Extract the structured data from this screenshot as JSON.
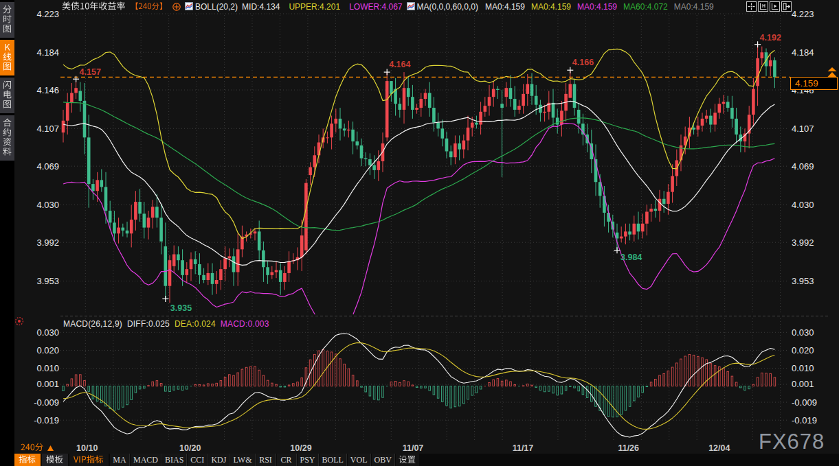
{
  "window": {
    "watermark": "FX678"
  },
  "icons": {
    "titlebar": [
      "collapse-indicator-icon",
      "boll-mini-chart-icon",
      "ma-mini-chart-icon"
    ],
    "top_right": [
      "pan-tool-icon",
      "axis-scale-k-icon",
      "axis-play-icon",
      "exit-chart-icon"
    ],
    "macd_panel": [
      "macd-indicator-icon"
    ],
    "price_axis": [
      "price-up-marker-icon"
    ],
    "period_row": [
      "period-dropdown-arrow-icon"
    ]
  },
  "colors": {
    "background": "#131313",
    "accent": "#ff8a00",
    "up": "#f0484e",
    "down": "#3fbd8e",
    "upper": "#ded535",
    "mid": "#f2f2f2",
    "lower": "#e23ce2",
    "ma60": "#2ca84e",
    "diff_line": "#f2f2f2",
    "dea_line": "#d8c42e",
    "hist_up": "#d34a4a",
    "hist_down": "#3aa880",
    "grid": "#3b3b3b"
  },
  "sidebar": {
    "items": [
      {
        "label": "分时图",
        "active": false
      },
      {
        "label": "K线图",
        "active": true
      },
      {
        "label": "闪电图",
        "active": false
      },
      {
        "label": "合约资料",
        "active": false
      }
    ]
  },
  "titlebar": {
    "instrument": "美债10年收益率",
    "period": "【240分】",
    "boll": {
      "name": "BOLL(20,2)",
      "mid": "MID:4.134",
      "upper": "UPPER:4.201",
      "lower": "LOWER:4.067"
    },
    "ma": {
      "name": "MA(0,0,0,60,0,0)",
      "ma0_white": "MA0:4.159",
      "ma0_yellow": "MA0:4.159",
      "ma0_magenta": "MA0:4.159",
      "ma60": "MA60:4.072",
      "ma0_gray": "MA0:4.159"
    }
  },
  "main_chart": {
    "current_price_label": "4.159"
  },
  "macd": {
    "header": {
      "name": "MACD(26,12,9)",
      "diff": "DIFF:0.025",
      "dea": "DEA:0.024",
      "macd": "MACD:0.003"
    }
  },
  "time_axis": {
    "period": "240分"
  },
  "bottom_toolbar": {
    "tabs": [
      {
        "label": "指标",
        "active": true,
        "vip": false
      },
      {
        "label": "模板",
        "active": false,
        "vip": false
      },
      {
        "label": "VIP指标",
        "active": false,
        "vip": true
      }
    ],
    "indicators": [
      "MA",
      "MACD",
      "BIAS",
      "CCI",
      "KDJ",
      "LW&",
      "RSI",
      "CR",
      "PSY",
      "BOLL",
      "VOL",
      "OBV"
    ],
    "settings": "设置"
  },
  "chart_data": [
    {
      "type": "candlestick",
      "title": "美债10年收益率【240分】",
      "period": "240分",
      "ylim": [
        3.928,
        4.231
      ],
      "y_ticks": [
        4.223,
        4.184,
        4.146,
        4.107,
        4.069,
        4.03,
        3.992,
        3.953
      ],
      "x_ticks": [
        {
          "label": "10/10",
          "bar": 5.6
        },
        {
          "label": "10/20",
          "bar": 29.8
        },
        {
          "label": "10/29",
          "bar": 55.8
        },
        {
          "label": "11/07",
          "bar": 82.1
        },
        {
          "label": "11/17",
          "bar": 107.9
        },
        {
          "label": "11/26",
          "bar": 132.7
        },
        {
          "label": "12/04",
          "bar": 154.0
        }
      ],
      "overlays": [
        {
          "name": "BOLL(20,2) UPPER",
          "color": "#ded535",
          "last": 4.201
        },
        {
          "name": "BOLL(20,2) MID",
          "color": "#f2f2f2",
          "last": 4.134
        },
        {
          "name": "BOLL(20,2) LOWER",
          "color": "#e23ce2",
          "last": 4.067
        },
        {
          "name": "MA60",
          "color": "#2ca84e",
          "last": 4.072
        }
      ],
      "annotations": [
        {
          "text": "4.157",
          "bar": 3,
          "at": "high",
          "color": "#cb3c32",
          "dx": 5,
          "dy": -6
        },
        {
          "text": "3.935",
          "bar": 24,
          "at": "low",
          "color": "#2fae7c",
          "dx": 7,
          "dy": 18
        },
        {
          "text": "4.164",
          "bar": 76,
          "at": "high",
          "color": "#cb3c32",
          "dx": 3,
          "dy": -7
        },
        {
          "text": "4.166",
          "bar": 119,
          "at": "high",
          "color": "#cb3c32",
          "dx": 3,
          "dy": -7
        },
        {
          "text": "3.984",
          "bar": 130,
          "at": "low",
          "color": "#2fae7c",
          "dx": 5,
          "dy": 14
        },
        {
          "text": "4.192",
          "bar": 163,
          "at": "high",
          "color": "#cb3c32",
          "dx": 3,
          "dy": -6
        }
      ],
      "current_price": 4.159,
      "ohlc": [
        [
          4.103,
          4.126,
          4.093,
          4.115
        ],
        [
          4.115,
          4.143,
          4.101,
          4.133
        ],
        [
          4.133,
          4.153,
          4.123,
          4.143
        ],
        [
          4.143,
          4.157,
          4.137,
          4.148
        ],
        [
          4.145,
          4.154,
          4.124,
          4.135
        ],
        [
          4.135,
          4.153,
          4.081,
          4.098
        ],
        [
          4.098,
          4.121,
          4.027,
          4.051
        ],
        [
          4.051,
          4.056,
          4.035,
          4.044
        ],
        [
          4.044,
          4.063,
          4.033,
          4.055
        ],
        [
          4.055,
          4.066,
          4.043,
          4.048
        ],
        [
          4.048,
          4.063,
          4.011,
          4.024
        ],
        [
          4.024,
          4.034,
          4.005,
          4.012
        ],
        [
          4.012,
          4.024,
          3.993,
          4.001
        ],
        [
          4.001,
          4.017,
          3.991,
          4.007
        ],
        [
          4.007,
          4.011,
          3.998,
          4.004
        ],
        [
          4.004,
          4.013,
          3.997,
          4.001
        ],
        [
          4.001,
          4.03,
          3.987,
          4.015
        ],
        [
          4.015,
          4.044,
          4.004,
          4.033
        ],
        [
          4.033,
          4.046,
          4.013,
          4.021
        ],
        [
          4.021,
          4.033,
          3.996,
          4.007
        ],
        [
          4.007,
          4.024,
          3.995,
          4.017
        ],
        [
          4.017,
          4.035,
          4.006,
          4.028
        ],
        [
          4.028,
          4.041,
          4.007,
          4.017
        ],
        [
          4.017,
          4.031,
          3.98,
          3.993
        ],
        [
          3.988,
          4.012,
          3.935,
          3.948
        ],
        [
          3.948,
          3.979,
          3.931,
          3.974
        ],
        [
          3.968,
          3.989,
          3.961,
          3.98
        ],
        [
          3.98,
          3.988,
          3.964,
          3.974
        ],
        [
          3.974,
          3.985,
          3.948,
          3.959
        ],
        [
          3.959,
          3.972,
          3.951,
          3.965
        ],
        [
          3.965,
          3.982,
          3.953,
          3.975
        ],
        [
          3.975,
          3.983,
          3.96,
          3.97
        ],
        [
          3.97,
          3.981,
          3.95,
          3.959
        ],
        [
          3.959,
          3.966,
          3.951,
          3.954
        ],
        [
          3.954,
          3.971,
          3.949,
          3.961
        ],
        [
          3.961,
          3.971,
          3.939,
          3.95
        ],
        [
          3.95,
          3.963,
          3.94,
          3.954
        ],
        [
          3.954,
          3.974,
          3.944,
          3.965
        ],
        [
          3.965,
          3.988,
          3.953,
          3.976
        ],
        [
          3.976,
          3.986,
          3.967,
          3.978
        ],
        [
          3.978,
          3.986,
          3.948,
          3.962
        ],
        [
          3.962,
          4.001,
          3.948,
          3.985
        ],
        [
          3.985,
          4.009,
          3.977,
          3.998
        ],
        [
          3.998,
          4.003,
          3.993,
          4.0
        ],
        [
          4.0,
          4.006,
          3.996,
          4.001
        ],
        [
          4.001,
          4.006,
          3.994,
          4.003
        ],
        [
          4.003,
          4.014,
          3.974,
          3.984
        ],
        [
          3.984,
          3.993,
          3.952,
          3.967
        ],
        [
          3.967,
          3.973,
          3.95,
          3.959
        ],
        [
          3.959,
          3.968,
          3.955,
          3.962
        ],
        [
          3.962,
          3.973,
          3.956,
          3.964
        ],
        [
          3.964,
          3.971,
          3.939,
          3.952
        ],
        [
          3.952,
          3.968,
          3.944,
          3.961
        ],
        [
          3.961,
          3.983,
          3.952,
          3.973
        ],
        [
          3.973,
          3.981,
          3.97,
          3.974
        ],
        [
          3.974,
          3.987,
          3.964,
          3.977
        ],
        [
          3.977,
          4.015,
          3.963,
          3.999
        ],
        [
          3.984,
          4.056,
          3.98,
          4.052
        ],
        [
          4.06,
          4.073,
          4.05,
          4.068
        ],
        [
          4.068,
          4.089,
          4.058,
          4.08
        ],
        [
          4.08,
          4.101,
          4.072,
          4.093
        ],
        [
          4.093,
          4.107,
          4.087,
          4.098
        ],
        [
          4.098,
          4.104,
          4.092,
          4.098
        ],
        [
          4.098,
          4.12,
          4.086,
          4.112
        ],
        [
          4.112,
          4.127,
          4.103,
          4.117
        ],
        [
          4.117,
          4.128,
          4.095,
          4.107
        ],
        [
          4.107,
          4.112,
          4.099,
          4.105
        ],
        [
          4.105,
          4.115,
          4.098,
          4.106
        ],
        [
          4.106,
          4.114,
          4.081,
          4.094
        ],
        [
          4.094,
          4.104,
          4.086,
          4.09
        ],
        [
          4.09,
          4.097,
          4.069,
          4.077
        ],
        [
          4.077,
          4.083,
          4.069,
          4.076
        ],
        [
          4.076,
          4.082,
          4.06,
          4.07
        ],
        [
          4.07,
          4.08,
          4.056,
          4.065
        ],
        [
          4.065,
          4.085,
          4.054,
          4.074
        ],
        [
          4.074,
          4.103,
          4.063,
          4.092
        ],
        [
          4.098,
          4.164,
          4.094,
          4.155
        ],
        [
          4.155,
          4.155,
          4.134,
          4.142
        ],
        [
          4.147,
          4.158,
          4.12,
          4.132
        ],
        [
          4.132,
          4.138,
          4.118,
          4.126
        ],
        [
          4.126,
          4.164,
          4.112,
          4.148
        ],
        [
          4.148,
          4.16,
          4.13,
          4.139
        ],
        [
          4.139,
          4.151,
          4.117,
          4.126
        ],
        [
          4.126,
          4.132,
          4.122,
          4.128
        ],
        [
          4.128,
          4.143,
          4.119,
          4.137
        ],
        [
          4.137,
          4.147,
          4.13,
          4.143
        ],
        [
          4.143,
          4.154,
          4.119,
          4.128
        ],
        [
          4.128,
          4.139,
          4.104,
          4.113
        ],
        [
          4.113,
          4.123,
          4.099,
          4.107
        ],
        [
          4.107,
          4.116,
          4.089,
          4.097
        ],
        [
          4.097,
          4.104,
          4.077,
          4.084
        ],
        [
          4.084,
          4.09,
          4.07,
          4.078
        ],
        [
          4.078,
          4.1,
          4.071,
          4.092
        ],
        [
          4.092,
          4.1,
          4.075,
          4.086
        ],
        [
          4.086,
          4.101,
          4.077,
          4.095
        ],
        [
          4.095,
          4.12,
          4.085,
          4.108
        ],
        [
          4.108,
          4.119,
          4.099,
          4.113
        ],
        [
          4.113,
          4.12,
          4.107,
          4.111
        ],
        [
          4.111,
          4.134,
          4.101,
          4.124
        ],
        [
          4.124,
          4.139,
          4.119,
          4.13
        ],
        [
          4.13,
          4.151,
          4.12,
          4.139
        ],
        [
          4.139,
          4.155,
          4.129,
          4.147
        ],
        [
          4.147,
          4.15,
          4.137,
          4.146
        ],
        [
          4.132,
          4.146,
          4.058,
          4.128
        ],
        [
          4.139,
          4.154,
          4.129,
          4.148
        ],
        [
          4.148,
          4.161,
          4.129,
          4.137
        ],
        [
          4.137,
          4.15,
          4.119,
          4.126
        ],
        [
          4.126,
          4.136,
          4.122,
          4.13
        ],
        [
          4.13,
          4.152,
          4.122,
          4.142
        ],
        [
          4.142,
          4.162,
          4.13,
          4.152
        ],
        [
          4.152,
          4.163,
          4.131,
          4.14
        ],
        [
          4.14,
          4.151,
          4.121,
          4.131
        ],
        [
          4.131,
          4.136,
          4.114,
          4.123
        ],
        [
          4.123,
          4.131,
          4.114,
          4.124
        ],
        [
          4.124,
          4.145,
          4.116,
          4.133
        ],
        [
          4.133,
          4.147,
          4.109,
          4.118
        ],
        [
          4.118,
          4.127,
          4.102,
          4.111
        ],
        [
          4.111,
          4.135,
          4.099,
          4.125
        ],
        [
          4.125,
          4.153,
          4.114,
          4.142
        ],
        [
          4.138,
          4.166,
          4.138,
          4.152
        ],
        [
          4.152,
          4.157,
          4.12,
          4.128
        ],
        [
          4.126,
          4.133,
          4.102,
          4.112
        ],
        [
          4.112,
          4.122,
          4.09,
          4.101
        ],
        [
          4.101,
          4.112,
          4.083,
          4.092
        ],
        [
          4.092,
          4.106,
          4.062,
          4.076
        ],
        [
          4.076,
          4.091,
          4.039,
          4.053
        ],
        [
          4.053,
          4.061,
          4.027,
          4.039
        ],
        [
          4.039,
          4.049,
          4.008,
          4.022
        ],
        [
          4.022,
          4.03,
          4.002,
          4.013
        ],
        [
          4.013,
          4.02,
          3.997,
          4.005
        ],
        [
          4.002,
          4.011,
          3.984,
          3.996
        ],
        [
          3.996,
          4.008,
          3.992,
          3.998
        ],
        [
          3.998,
          4.011,
          3.99,
          4.003
        ],
        [
          4.003,
          4.011,
          3.994,
          4.0
        ],
        [
          4.0,
          4.019,
          3.993,
          4.011
        ],
        [
          4.011,
          4.023,
          3.995,
          4.003
        ],
        [
          4.003,
          4.021,
          3.996,
          4.011
        ],
        [
          4.011,
          4.03,
          3.999,
          4.023
        ],
        [
          4.023,
          4.031,
          4.013,
          4.026
        ],
        [
          4.026,
          4.035,
          4.017,
          4.024
        ],
        [
          4.024,
          4.045,
          4.013,
          4.036
        ],
        [
          4.036,
          4.044,
          4.022,
          4.031
        ],
        [
          4.031,
          4.051,
          4.02,
          4.043
        ],
        [
          4.043,
          4.071,
          4.032,
          4.059
        ],
        [
          4.059,
          4.086,
          4.049,
          4.075
        ],
        [
          4.075,
          4.101,
          4.064,
          4.09
        ],
        [
          4.09,
          4.109,
          4.081,
          4.099
        ],
        [
          4.099,
          4.119,
          4.087,
          4.108
        ],
        [
          4.108,
          4.113,
          4.101,
          4.106
        ],
        [
          4.106,
          4.119,
          4.099,
          4.11
        ],
        [
          4.11,
          4.123,
          4.104,
          4.117
        ],
        [
          4.117,
          4.126,
          4.113,
          4.12
        ],
        [
          4.12,
          4.127,
          4.103,
          4.111
        ],
        [
          4.111,
          4.132,
          4.104,
          4.123
        ],
        [
          4.123,
          4.138,
          4.117,
          4.132
        ],
        [
          4.132,
          4.141,
          4.122,
          4.134
        ],
        [
          4.134,
          4.14,
          4.124,
          4.128
        ],
        [
          4.128,
          4.14,
          4.108,
          4.117
        ],
        [
          4.117,
          4.128,
          4.092,
          4.101
        ],
        [
          4.101,
          4.109,
          4.083,
          4.094
        ],
        [
          4.094,
          4.107,
          4.083,
          4.102
        ],
        [
          4.102,
          4.13,
          4.087,
          4.121
        ],
        [
          4.121,
          4.158,
          4.109,
          4.147
        ],
        [
          4.15,
          4.192,
          4.13,
          4.178
        ],
        [
          4.178,
          4.19,
          4.171,
          4.184
        ],
        [
          4.184,
          4.188,
          4.16,
          4.17
        ],
        [
          4.17,
          4.182,
          4.16,
          4.176
        ],
        [
          4.176,
          4.179,
          4.148,
          4.159
        ]
      ]
    },
    {
      "type": "macd",
      "name": "MACD(26,12,9)",
      "diff": 0.025,
      "dea": 0.024,
      "macd": 0.003,
      "y_ticks": [
        0.03,
        0.02,
        0.01,
        0.001,
        -0.009,
        -0.019
      ],
      "computed_from": "chart_data[0].ohlc closes"
    }
  ]
}
